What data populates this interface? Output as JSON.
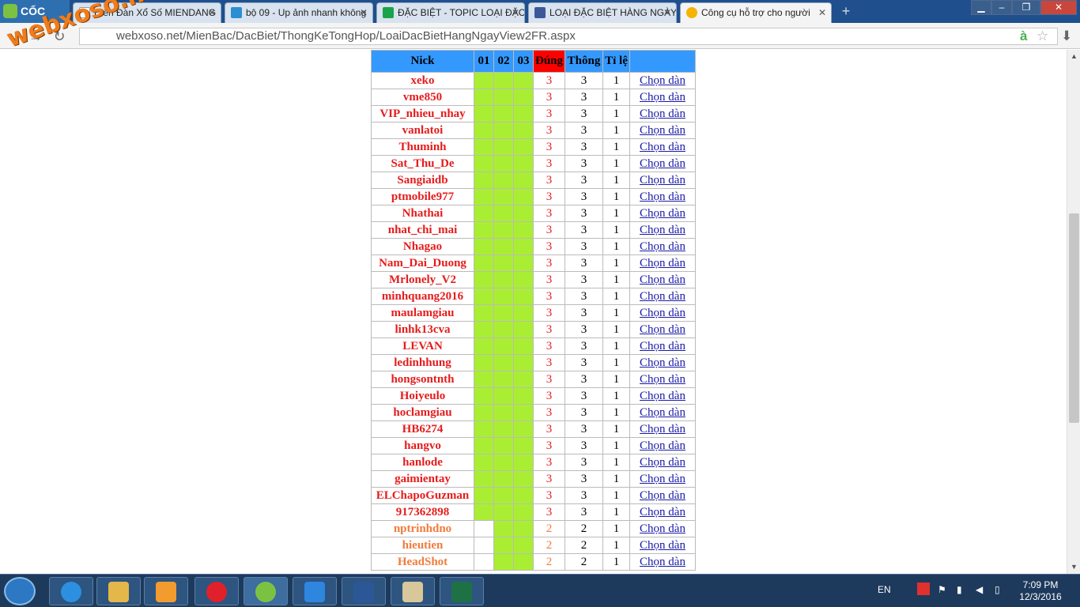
{
  "browser": {
    "brand": "CỐC CỐC",
    "tabs": [
      {
        "title": "Diễn Đàn Xổ Số MIENDANG",
        "active": false
      },
      {
        "title": "bộ 09 - Up ảnh nhanh không",
        "active": false
      },
      {
        "title": "ĐẶC BIỆT - TOPIC LOẠI ĐẶC",
        "active": false
      },
      {
        "title": "LOẠI ĐẶC BIỆT HÀNG NGÀY",
        "active": false
      },
      {
        "title": "Công cụ hỗ trợ cho người",
        "active": true
      }
    ],
    "url": "webxoso.net/MienBac/DacBiet/ThongKeTongHop/LoaiDacBietHangNgayView2FR.aspx",
    "watermark": "webxoso.net"
  },
  "table": {
    "headers": [
      "Nick",
      "01",
      "02",
      "03",
      "Đúng",
      "Thông",
      "Tỉ lệ",
      ""
    ],
    "rows": [
      {
        "nick": "xeko",
        "c1": true,
        "c2": true,
        "c3": true,
        "dung": "3",
        "thong": "3",
        "tile": "1",
        "link": "Chọn dàn"
      },
      {
        "nick": "vme850",
        "c1": true,
        "c2": true,
        "c3": true,
        "dung": "3",
        "thong": "3",
        "tile": "1",
        "link": "Chọn dàn"
      },
      {
        "nick": "VIP_nhieu_nhay",
        "c1": true,
        "c2": true,
        "c3": true,
        "dung": "3",
        "thong": "3",
        "tile": "1",
        "link": "Chọn dàn"
      },
      {
        "nick": "vanlatoi",
        "c1": true,
        "c2": true,
        "c3": true,
        "dung": "3",
        "thong": "3",
        "tile": "1",
        "link": "Chọn dàn"
      },
      {
        "nick": "Thuminh",
        "c1": true,
        "c2": true,
        "c3": true,
        "dung": "3",
        "thong": "3",
        "tile": "1",
        "link": "Chọn dàn"
      },
      {
        "nick": "Sat_Thu_De",
        "c1": true,
        "c2": true,
        "c3": true,
        "dung": "3",
        "thong": "3",
        "tile": "1",
        "link": "Chọn dàn"
      },
      {
        "nick": "Sangiaidb",
        "c1": true,
        "c2": true,
        "c3": true,
        "dung": "3",
        "thong": "3",
        "tile": "1",
        "link": "Chọn dàn"
      },
      {
        "nick": "ptmobile977",
        "c1": true,
        "c2": true,
        "c3": true,
        "dung": "3",
        "thong": "3",
        "tile": "1",
        "link": "Chọn dàn"
      },
      {
        "nick": "Nhathai",
        "c1": true,
        "c2": true,
        "c3": true,
        "dung": "3",
        "thong": "3",
        "tile": "1",
        "link": "Chọn dàn"
      },
      {
        "nick": "nhat_chi_mai",
        "c1": true,
        "c2": true,
        "c3": true,
        "dung": "3",
        "thong": "3",
        "tile": "1",
        "link": "Chọn dàn"
      },
      {
        "nick": "Nhagao",
        "c1": true,
        "c2": true,
        "c3": true,
        "dung": "3",
        "thong": "3",
        "tile": "1",
        "link": "Chọn dàn"
      },
      {
        "nick": "Nam_Dai_Duong",
        "c1": true,
        "c2": true,
        "c3": true,
        "dung": "3",
        "thong": "3",
        "tile": "1",
        "link": "Chọn dàn"
      },
      {
        "nick": "Mrlonely_V2",
        "c1": true,
        "c2": true,
        "c3": true,
        "dung": "3",
        "thong": "3",
        "tile": "1",
        "link": "Chọn dàn"
      },
      {
        "nick": "minhquang2016",
        "c1": true,
        "c2": true,
        "c3": true,
        "dung": "3",
        "thong": "3",
        "tile": "1",
        "link": "Chọn dàn"
      },
      {
        "nick": "maulamgiau",
        "c1": true,
        "c2": true,
        "c3": true,
        "dung": "3",
        "thong": "3",
        "tile": "1",
        "link": "Chọn dàn"
      },
      {
        "nick": "linhk13cva",
        "c1": true,
        "c2": true,
        "c3": true,
        "dung": "3",
        "thong": "3",
        "tile": "1",
        "link": "Chọn dàn"
      },
      {
        "nick": "LEVAN",
        "c1": true,
        "c2": true,
        "c3": true,
        "dung": "3",
        "thong": "3",
        "tile": "1",
        "link": "Chọn dàn"
      },
      {
        "nick": "ledinhhung",
        "c1": true,
        "c2": true,
        "c3": true,
        "dung": "3",
        "thong": "3",
        "tile": "1",
        "link": "Chọn dàn"
      },
      {
        "nick": "hongsontnth",
        "c1": true,
        "c2": true,
        "c3": true,
        "dung": "3",
        "thong": "3",
        "tile": "1",
        "link": "Chọn dàn"
      },
      {
        "nick": "Hoiyeulo",
        "c1": true,
        "c2": true,
        "c3": true,
        "dung": "3",
        "thong": "3",
        "tile": "1",
        "link": "Chọn dàn"
      },
      {
        "nick": "hoclamgiau",
        "c1": true,
        "c2": true,
        "c3": true,
        "dung": "3",
        "thong": "3",
        "tile": "1",
        "link": "Chọn dàn"
      },
      {
        "nick": "HB6274",
        "c1": true,
        "c2": true,
        "c3": true,
        "dung": "3",
        "thong": "3",
        "tile": "1",
        "link": "Chọn dàn"
      },
      {
        "nick": "hangvo",
        "c1": true,
        "c2": true,
        "c3": true,
        "dung": "3",
        "thong": "3",
        "tile": "1",
        "link": "Chọn dàn"
      },
      {
        "nick": "hanlode",
        "c1": true,
        "c2": true,
        "c3": true,
        "dung": "3",
        "thong": "3",
        "tile": "1",
        "link": "Chọn dàn"
      },
      {
        "nick": "gaimientay",
        "c1": true,
        "c2": true,
        "c3": true,
        "dung": "3",
        "thong": "3",
        "tile": "1",
        "link": "Chọn dàn"
      },
      {
        "nick": "ELChapoGuzman",
        "c1": true,
        "c2": true,
        "c3": true,
        "dung": "3",
        "thong": "3",
        "tile": "1",
        "link": "Chọn dàn"
      },
      {
        "nick": "917362898",
        "c1": true,
        "c2": true,
        "c3": true,
        "dung": "3",
        "thong": "3",
        "tile": "1",
        "link": "Chọn dàn"
      },
      {
        "nick": "nptrinhdno",
        "c1": false,
        "c2": true,
        "c3": true,
        "dung": "2",
        "thong": "2",
        "tile": "1",
        "link": "Chọn dàn"
      },
      {
        "nick": "hieutien",
        "c1": false,
        "c2": true,
        "c3": true,
        "dung": "2",
        "thong": "2",
        "tile": "1",
        "link": "Chọn dàn"
      },
      {
        "nick": "HeadShot",
        "c1": false,
        "c2": true,
        "c3": true,
        "dung": "2",
        "thong": "2",
        "tile": "1",
        "link": "Chọn dàn"
      }
    ]
  },
  "taskbar": {
    "lang": "EN",
    "time": "7:09 PM",
    "date": "12/3/2016"
  },
  "colors": {
    "header_blue": "#3399ff",
    "header_red": "#ff0000",
    "hit_green": "#aaee33",
    "nick_red": "#e51c1c",
    "nick_orange": "#f07c3c",
    "link_blue": "#1a1aa6"
  }
}
